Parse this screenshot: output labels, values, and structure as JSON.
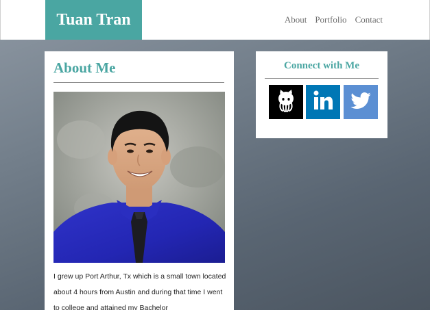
{
  "header": {
    "brand": "Tuan Tran",
    "nav": [
      {
        "label": "About"
      },
      {
        "label": "Portfolio"
      },
      {
        "label": "Contact"
      }
    ]
  },
  "about": {
    "title": "About Me",
    "photo_alt": "Portrait photo",
    "text": "I grew up Port Arthur, Tx which is a small town located about 4 hours from Austin and during that time I went to college and attained my Bachelor"
  },
  "connect": {
    "title": "Connect with Me",
    "links": [
      {
        "icon": "github-icon",
        "label": "GitHub",
        "color": "#000000"
      },
      {
        "icon": "linkedin-icon",
        "label": "LinkedIn",
        "color": "#0077b5"
      },
      {
        "icon": "twitter-icon",
        "label": "Twitter",
        "color": "#5b8fd3"
      }
    ]
  },
  "colors": {
    "accent": "#4aa6a2",
    "nav_text": "#6d6d6d"
  }
}
